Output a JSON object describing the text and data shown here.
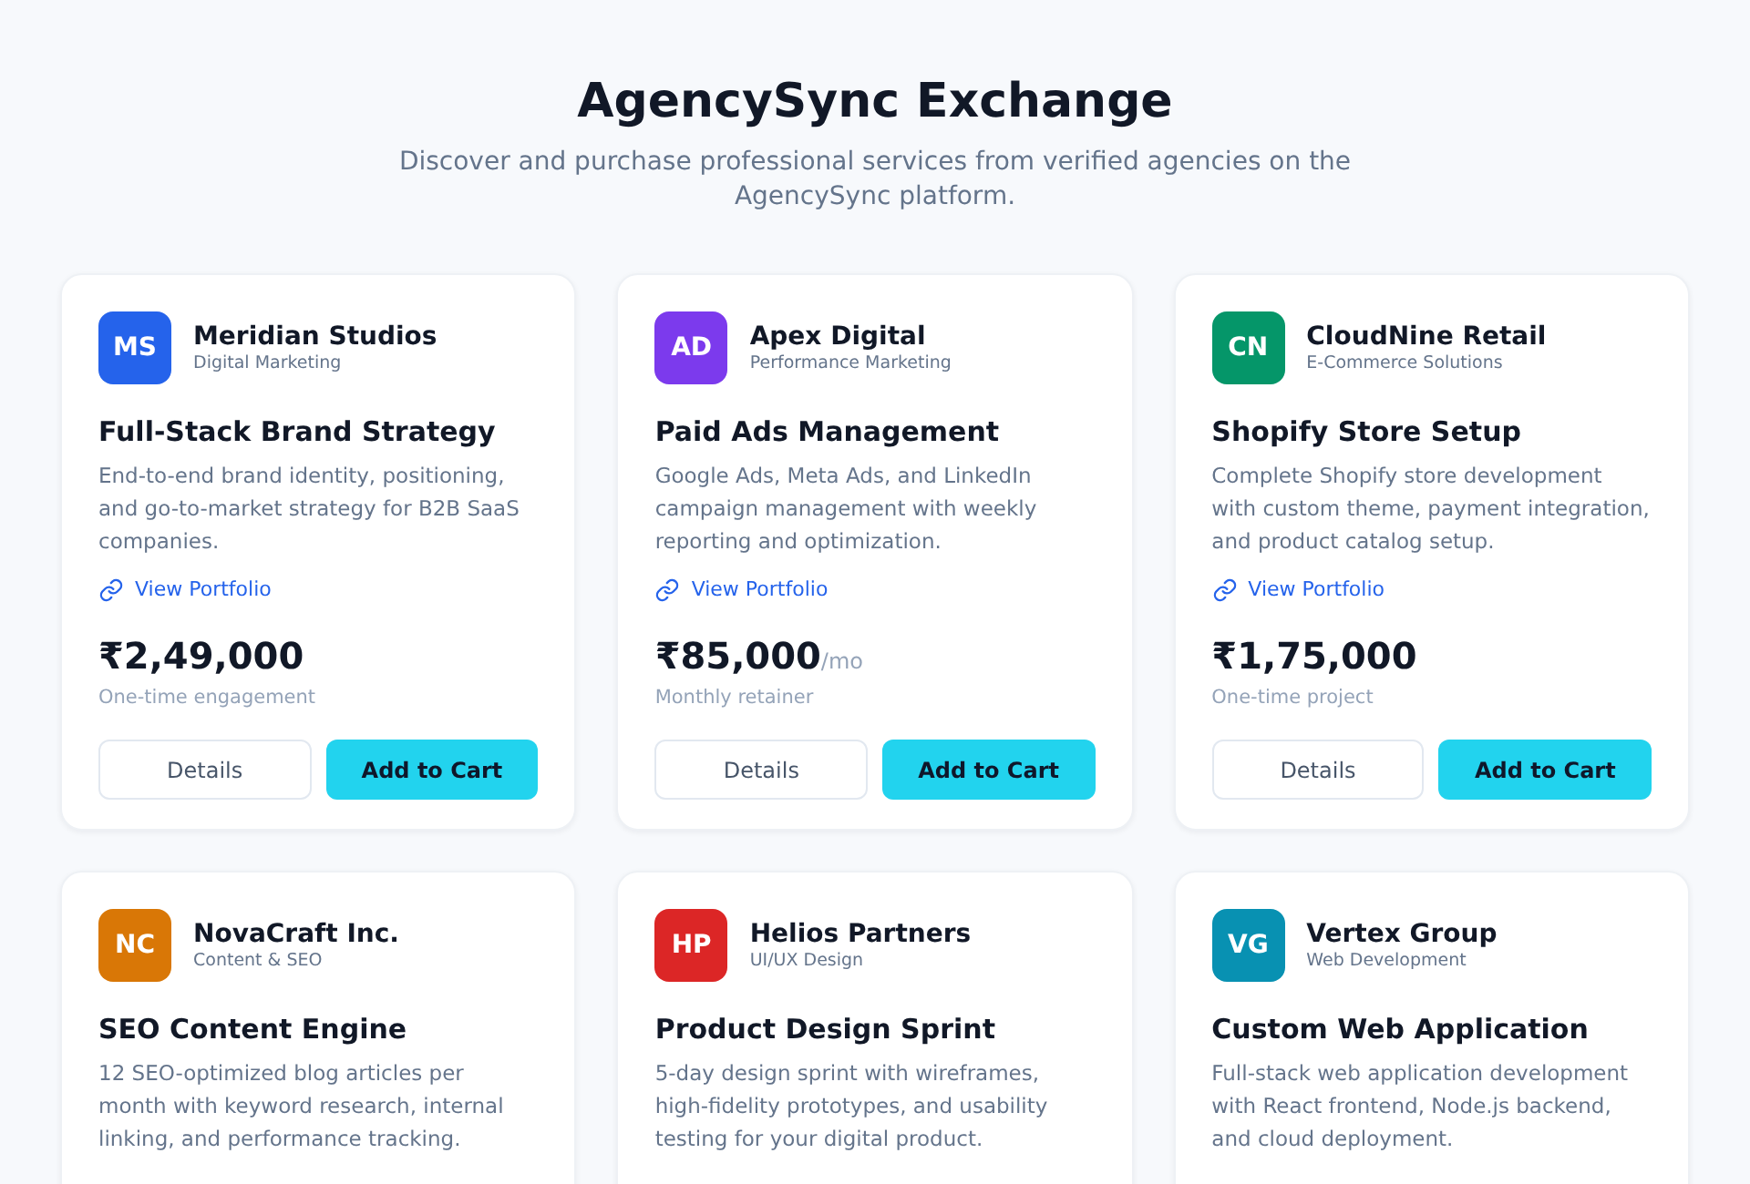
{
  "header": {
    "title": "AgencySync Exchange",
    "subtitle": "Discover and purchase professional services from verified agencies on the AgencySync platform."
  },
  "services": [
    {
      "initials": "MS",
      "color": "#2563eb",
      "agency": "Meridian Studios",
      "category": "Digital Marketing",
      "title": "Full-Stack Brand Strategy",
      "description": "End-to-end brand identity, positioning, and go-to-market strategy for B2B SaaS companies.",
      "link": "View Portfolio",
      "price": "₹2,49,000",
      "billing": "One-time engagement",
      "buttons": [
        "Details",
        "Add to Cart"
      ]
    },
    {
      "initials": "AD",
      "color": "#7c3aed",
      "agency": "Apex Digital",
      "category": "Performance Marketing",
      "title": "Paid Ads Management",
      "description": "Google Ads, Meta Ads, and LinkedIn campaign management with weekly reporting and optimization.",
      "link": "View Portfolio",
      "price": "₹85,000",
      "price_suffix": "/mo",
      "billing": "Monthly retainer",
      "buttons": [
        "Details",
        "Add to Cart"
      ]
    },
    {
      "initials": "CN",
      "color": "#059669",
      "agency": "CloudNine Retail",
      "category": "E-Commerce Solutions",
      "title": "Shopify Store Setup",
      "description": "Complete Shopify store development with custom theme, payment integration, and product catalog setup.",
      "link": "View Portfolio",
      "price": "₹1,75,000",
      "billing": "One-time project",
      "buttons": [
        "Details",
        "Add to Cart"
      ]
    },
    {
      "initials": "NC",
      "color": "#d97706",
      "agency": "NovaCraft Inc.",
      "category": "Content & SEO",
      "title": "SEO Content Engine",
      "description": "12 SEO-optimized blog articles per month with keyword research, internal linking, and performance tracking."
    },
    {
      "initials": "HP",
      "color": "#dc2626",
      "agency": "Helios Partners",
      "category": "UI/UX Design",
      "title": "Product Design Sprint",
      "description": "5-day design sprint with wireframes, high-fidelity prototypes, and usability testing for your digital product."
    },
    {
      "initials": "VG",
      "color": "#0891b2",
      "agency": "Vertex Group",
      "category": "Web Development",
      "title": "Custom Web Application",
      "description": "Full-stack web application development with React frontend, Node.js backend, and cloud deployment."
    }
  ]
}
